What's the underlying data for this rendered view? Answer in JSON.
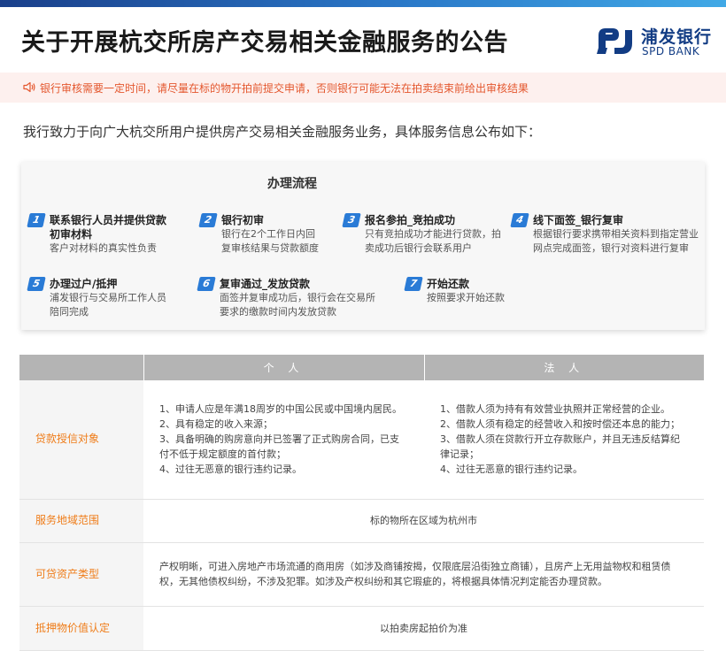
{
  "header": {
    "title": "关于开展杭交所房产交易相关金融服务的公告",
    "logo_cn": "浦发银行",
    "logo_en": "SPD BANK"
  },
  "notice": {
    "text": "银行审核需要一定时间，请尽量在标的物开拍前提交申请，否则银行可能无法在拍卖结束前给出审核结果"
  },
  "intro": "我行致力于向广大杭交所用户提供房产交易相关金融服务业务，具体服务信息公布如下：",
  "process": {
    "title": "办理流程",
    "steps": [
      {
        "num": "1",
        "title_lines": [
          "联系银行人员并提供贷款",
          "初审材料"
        ],
        "desc_lines": [
          "客户对材料的真实性负责"
        ]
      },
      {
        "num": "2",
        "title_lines": [
          "银行初审"
        ],
        "desc_lines": [
          "银行在2个工作日内回",
          "复审核结果与贷款额度"
        ]
      },
      {
        "num": "3",
        "title_lines": [
          "报名参拍_竞拍成功"
        ],
        "desc_lines": [
          "只有竞拍成功才能进行贷款，拍",
          "卖成功后银行会联系用户"
        ]
      },
      {
        "num": "4",
        "title_lines": [
          "线下面签_银行复审"
        ],
        "desc_lines": [
          "根据银行要求携带相关资料到指定营业",
          "网点完成面签，银行对资料进行复审"
        ]
      },
      {
        "num": "5",
        "title_lines": [
          "办理过户/抵押"
        ],
        "desc_lines": [
          "浦发银行与交易所工作人员",
          "陪同完成"
        ]
      },
      {
        "num": "6",
        "title_lines": [
          "复审通过_发放贷款"
        ],
        "desc_lines": [
          "面签并复审成功后，银行会在交易所",
          "要求的缴款时间内发放贷款"
        ]
      },
      {
        "num": "7",
        "title_lines": [
          "开始还款"
        ],
        "desc_lines": [
          "按照要求开始还款"
        ]
      }
    ]
  },
  "table": {
    "headers": [
      "",
      "个 人",
      "法 人"
    ],
    "rows": [
      {
        "label": "贷款授信对象",
        "personal": [
          "1、申请人应是年满18周岁的中国公民或中国境内居民。",
          "2、具有稳定的收入来源；",
          "3、具备明确的购房意向并已签署了正式购房合同，已支",
          "付不低于规定额度的首付款；",
          "4、过往无恶意的银行违约记录。"
        ],
        "corporate": [
          "1、借款人须为持有有效营业执照并正常经营的企业。",
          "2、借款人须有稳定的经营收入和按时偿还本息的能力；",
          "3、借款人须在贷款行开立存款账户，并且无违反结算纪",
          "律记录；",
          "4、过往无恶意的银行违约记录。"
        ]
      },
      {
        "label": "服务地域范围",
        "merged": [
          "标的物所在区域为杭州市"
        ]
      },
      {
        "label": "可贷资产类型",
        "merged": [
          "产权明晰，可进入房地产市场流通的商用房（如涉及商铺按揭，仅限底层沿街独立商铺），且房产上无用益物权和租赁债",
          "权，无其他债权纠纷，不涉及犯罪。如涉及产权纠纷和其它瑕疵的，将根据具体情况判定能否办理贷款。"
        ]
      },
      {
        "label": "抵押物价值认定",
        "merged": [
          "以拍卖房起拍价为准"
        ]
      }
    ]
  },
  "colors": {
    "brand_blue": "#123c84",
    "step_blue": "#2a7bd6",
    "label_orange": "#ef7d1a",
    "notice_red": "#e4572e",
    "header_gray": "#b4b4b4"
  }
}
